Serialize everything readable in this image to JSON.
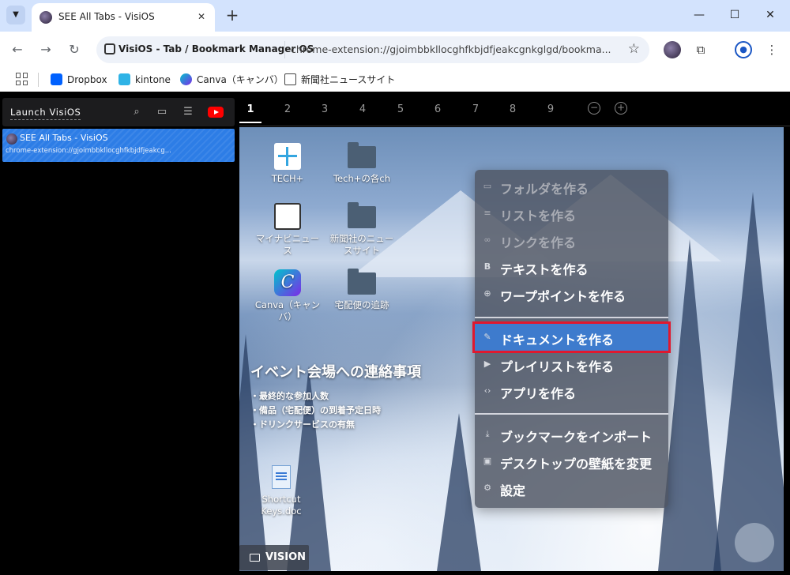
{
  "browser": {
    "tab_title": "SEE All Tabs - VisiOS",
    "new_tab": "+",
    "omnibox_site": "VisiOS - Tab / Bookmark Manager OS",
    "omnibox_url": "chrome-extension://gjoimbbkllocghfkbjdfjeakcgnkglgd/bookma...",
    "bookmarks": [
      "Dropbox",
      "kintone",
      "Canva（キャンバ）",
      "新聞社ニュースサイト"
    ]
  },
  "sidebar": {
    "launch_label": "Launch VisiOS",
    "tab_item": {
      "title": "SEE All Tabs - VisiOS",
      "url": "chrome-extension://gjoimbbkllocghfkbjdfjeakcg..."
    }
  },
  "desktop_tabs": [
    "1",
    "2",
    "3",
    "4",
    "5",
    "6",
    "7",
    "8",
    "9"
  ],
  "desktop": {
    "icons": [
      {
        "label": "TECH+"
      },
      {
        "label": "Tech+の各ch"
      },
      {
        "label": "マイナビニュース"
      },
      {
        "label": "新聞社のニュースサイト"
      },
      {
        "label": "Canva（キャンバ）"
      },
      {
        "label": "宅配便の追跡"
      },
      {
        "label": "Shortcut Keys.doc"
      }
    ],
    "note": {
      "title": "イベント会場への連絡事項",
      "items": [
        "・最終的な参加人数",
        "・備品（宅配便）の到着予定日時",
        "・ドリンクサービスの有無"
      ]
    },
    "vision_label": "VISION"
  },
  "context_menu": {
    "items": [
      {
        "label": "フォルダを作る",
        "icon": "folder-icon",
        "disabled": true
      },
      {
        "label": "リストを作る",
        "icon": "list-icon",
        "disabled": true
      },
      {
        "label": "リンクを作る",
        "icon": "link-icon",
        "disabled": true
      },
      {
        "label": "テキストを作る",
        "icon": "bold-icon"
      },
      {
        "label": "ワープポイントを作る",
        "icon": "globe-icon"
      },
      {
        "label": "ドキュメントを作る",
        "icon": "edit-icon",
        "highlighted": true
      },
      {
        "label": "プレイリストを作る",
        "icon": "youtube-icon"
      },
      {
        "label": "アプリを作る",
        "icon": "code-icon"
      },
      {
        "label": "ブックマークをインポート",
        "icon": "download-icon"
      },
      {
        "label": "デスクトップの壁紙を変更",
        "icon": "image-icon"
      },
      {
        "label": "設定",
        "icon": "settings-icon"
      }
    ],
    "highlight_color": "#e0182e"
  }
}
